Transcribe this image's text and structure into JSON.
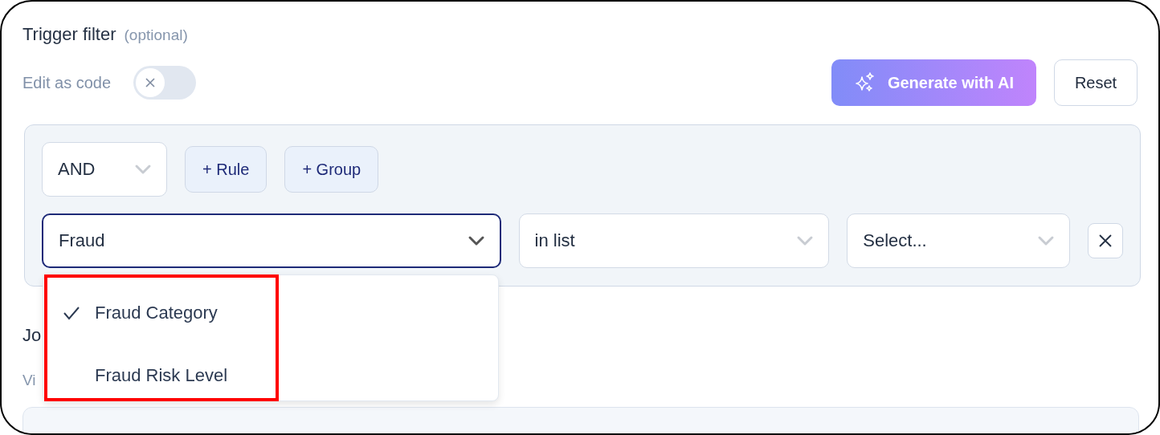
{
  "header": {
    "title": "Trigger filter",
    "hint": "(optional)"
  },
  "code_toggle": {
    "label": "Edit as code",
    "on": false
  },
  "actions": {
    "generate": "Generate with AI",
    "reset": "Reset"
  },
  "builder": {
    "combinator": "AND",
    "add_rule": "+ Rule",
    "add_group": "+ Group",
    "rule": {
      "field": "Fraud",
      "field_open": true,
      "operator": "in list",
      "value_placeholder": "Select..."
    },
    "field_options": [
      {
        "label": "Fraud Category",
        "selected": true
      },
      {
        "label": "Fraud Risk Level",
        "selected": false
      }
    ]
  },
  "below": {
    "heading": "Jo",
    "link": "Vi"
  }
}
